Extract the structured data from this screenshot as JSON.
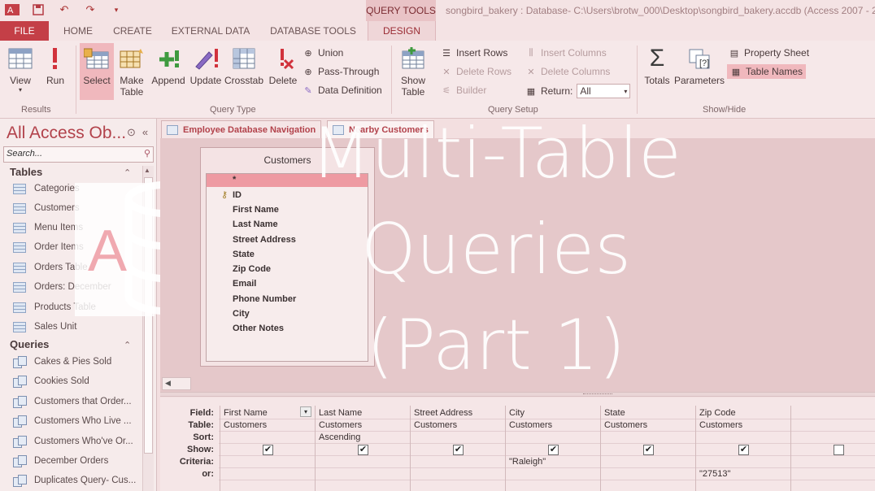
{
  "window": {
    "contextual_tab_group": "QUERY TOOLS",
    "title": "songbird_bakery : Database- C:\\Users\\brotw_000\\Desktop\\songbird_bakery.accdb (Access 2007 - 2"
  },
  "ribbon_tabs": [
    "FILE",
    "HOME",
    "CREATE",
    "EXTERNAL DATA",
    "DATABASE TOOLS",
    "DESIGN"
  ],
  "ribbon": {
    "results": {
      "title": "Results",
      "view": "View",
      "run": "Run"
    },
    "query_type": {
      "title": "Query Type",
      "select": "Select",
      "make_table_1": "Make",
      "make_table_2": "Table",
      "append": "Append",
      "update": "Update",
      "crosstab": "Crosstab",
      "delete": "Delete",
      "union": "Union",
      "pass_through": "Pass-Through",
      "data_definition": "Data Definition"
    },
    "query_setup": {
      "title": "Query Setup",
      "show_table_1": "Show",
      "show_table_2": "Table",
      "insert_rows": "Insert Rows",
      "delete_rows": "Delete Rows",
      "builder": "Builder",
      "insert_columns": "Insert Columns",
      "delete_columns": "Delete Columns",
      "return_label": "Return:",
      "return_value": "All"
    },
    "show_hide": {
      "title": "Show/Hide",
      "totals": "Totals",
      "parameters": "Parameters",
      "property_sheet": "Property Sheet",
      "table_names": "Table Names"
    }
  },
  "nav_pane": {
    "title": "All Access Ob...",
    "search_placeholder": "Search...",
    "tables_header": "Tables",
    "tables": [
      "Categories",
      "Customers",
      "Menu Items",
      "Order Items",
      "Orders Table",
      "Orders: December",
      "Products Table",
      "Sales Unit"
    ],
    "queries_header": "Queries",
    "queries": [
      "Cakes & Pies Sold",
      "Cookies Sold",
      "Customers that Order...",
      "Customers Who Live ...",
      "Customers Who've Or...",
      "December Orders",
      "Duplicates Query- Cus..."
    ]
  },
  "doc_tabs": [
    "Employee Database Navigation",
    "Nearby Customers"
  ],
  "table_box": {
    "title": "Customers",
    "fields": [
      "*",
      "ID",
      "First Name",
      "Last Name",
      "Street Address",
      "State",
      "Zip Code",
      "Email",
      "Phone Number",
      "City",
      "Other Notes"
    ]
  },
  "design_grid": {
    "row_labels": [
      "Field:",
      "Table:",
      "Sort:",
      "Show:",
      "Criteria:",
      "or:"
    ],
    "columns": [
      {
        "field": "First Name",
        "table": "Customers",
        "sort": "",
        "show": true,
        "criteria": "",
        "or": ""
      },
      {
        "field": "Last Name",
        "table": "Customers",
        "sort": "Ascending",
        "show": true,
        "criteria": "",
        "or": ""
      },
      {
        "field": "Street Address",
        "table": "Customers",
        "sort": "",
        "show": true,
        "criteria": "",
        "or": ""
      },
      {
        "field": "City",
        "table": "Customers",
        "sort": "",
        "show": true,
        "criteria": "\"Raleigh\"",
        "or": ""
      },
      {
        "field": "State",
        "table": "Customers",
        "sort": "",
        "show": true,
        "criteria": "",
        "or": ""
      },
      {
        "field": "Zip Code",
        "table": "Customers",
        "sort": "",
        "show": true,
        "criteria": "",
        "or": "\"27513\""
      },
      {
        "field": "",
        "table": "",
        "sort": "",
        "show": false,
        "criteria": "",
        "or": ""
      }
    ]
  },
  "overlay": {
    "line1": "Multi-Table",
    "line2": "Queries",
    "line3": "(Part 1)"
  },
  "colors": {
    "accent": "#c43f47",
    "selected": "#f0b8bd"
  }
}
